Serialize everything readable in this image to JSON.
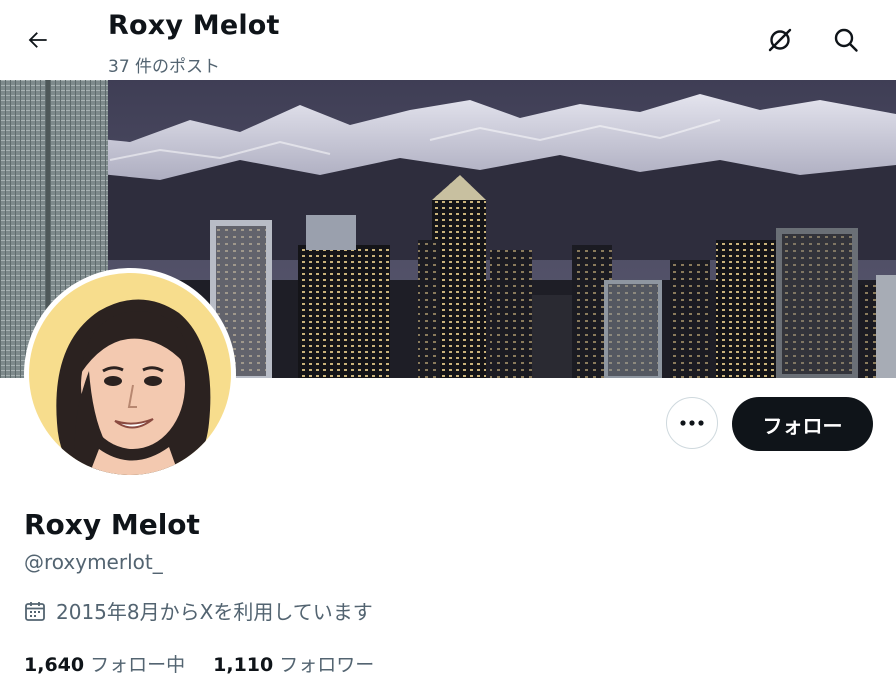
{
  "header": {
    "display_name": "Roxy Melot",
    "post_count": "37 件のポスト"
  },
  "profile": {
    "display_name": "Roxy Melot",
    "handle": "@roxymerlot_",
    "joined": "2015年8月からXを利用しています"
  },
  "actions": {
    "follow_label": "フォロー"
  },
  "stats": {
    "following_count": "1,640",
    "following_label": "フォロー中",
    "followers_count": "1,110",
    "followers_label": "フォロワー"
  },
  "icons": {
    "back": "arrow-left-icon",
    "grok": "grok-icon",
    "search": "search-icon",
    "more": "more-dots-icon",
    "calendar": "calendar-icon"
  },
  "colors": {
    "text": "#0f1419",
    "secondary": "#536471",
    "button": "#0f1419",
    "border": "#cfd9de"
  }
}
